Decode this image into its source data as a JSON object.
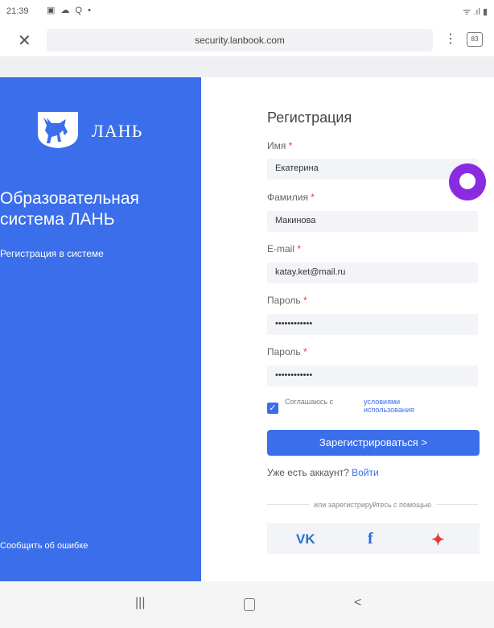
{
  "status_bar": {
    "time": "21:39",
    "indicator_icons": "▣ ☁ Q •",
    "right_icons": "ᯤ .ıl ▮"
  },
  "browser": {
    "close_glyph": "✕",
    "url": "security.lanbook.com",
    "menu_glyph": "⋮",
    "tabs_count": "83"
  },
  "sidebar": {
    "logo_text": "ЛАНЬ",
    "system_title": "Образовательная\nсистема ЛАНЬ",
    "subtitle": "Регистрация в системе",
    "report_link": "Сообщить об ошибке"
  },
  "form": {
    "title": "Регистрация",
    "name_label": "Имя",
    "name_value": "Екатерина",
    "surname_label": "Фамилия",
    "surname_value": "Макинова",
    "email_label": "E-mail",
    "email_value": "katay.ket@mail.ru",
    "password_label": "Пароль",
    "password_value": "••••••••••••",
    "password2_label": "Пароль",
    "password2_value": "••••••••••••",
    "required_mark": "*",
    "agree_text": "Соглашаюсь с",
    "terms_link": "условиями использования",
    "agree_checked": true,
    "register_label": "Зарегистрироваться >",
    "login_question": "Уже есть аккаунт?",
    "login_link": "Войти",
    "social_caption": "или зарегистрируйтесь с помощью",
    "social": {
      "vk": "VK",
      "facebook": "f",
      "other": "✦"
    }
  },
  "bottom_nav": {
    "recent": "|||",
    "back": "<"
  },
  "colors": {
    "accent": "#3a6eea",
    "assistant": "#8a2be2",
    "required": "#e53935"
  }
}
